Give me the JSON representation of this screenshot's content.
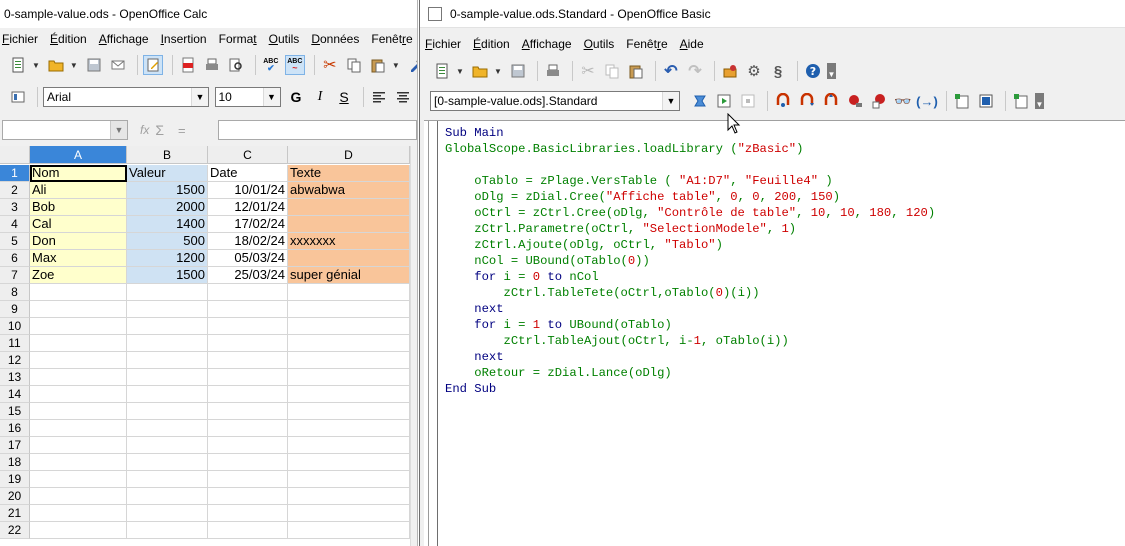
{
  "calc": {
    "title": "0-sample-value.ods - OpenOffice Calc",
    "menus": [
      "Fichier",
      "Édition",
      "Affichage",
      "Insertion",
      "Format",
      "Outils",
      "Données",
      "Fenêtre"
    ],
    "font_name": "Arial",
    "font_size": "10",
    "format_labels": {
      "bold": "G",
      "italic": "I",
      "underline": "S"
    },
    "formula_fx": "fx",
    "formula_sigma": "Σ",
    "formula_equals": "=",
    "name_box": "",
    "input_line": "",
    "columns": [
      "A",
      "B",
      "C",
      "D"
    ],
    "selected_column": "A",
    "row_numbers": [
      "1",
      "2",
      "3",
      "4",
      "5",
      "6",
      "7",
      "8",
      "9",
      "10",
      "11",
      "12",
      "13",
      "14",
      "15",
      "16",
      "17",
      "18",
      "19",
      "20",
      "21",
      "22"
    ],
    "rows": [
      [
        "Nom",
        "Valeur",
        "Date",
        "Texte"
      ],
      [
        "Ali",
        "1500",
        "10/01/24",
        "abwabwa"
      ],
      [
        "Bob",
        "2000",
        "12/01/24",
        ""
      ],
      [
        "Cal",
        "1400",
        "17/02/24",
        ""
      ],
      [
        "Don",
        "500",
        "18/02/24",
        "xxxxxxx"
      ],
      [
        "Max",
        "1200",
        "05/03/24",
        ""
      ],
      [
        "Zoe",
        "1500",
        "25/03/24",
        "super génial"
      ]
    ]
  },
  "basic": {
    "title": "0-sample-value.ods.Standard - OpenOffice Basic",
    "menus": [
      "Fichier",
      "Édition",
      "Affichage",
      "Outils",
      "Fenêtre",
      "Aide"
    ],
    "library_selector": "[0-sample-value.ods].Standard",
    "code_lines": [
      [
        {
          "t": "Sub Main",
          "c": "kw"
        }
      ],
      [
        {
          "t": "GlobalScope.BasicLibraries.loadLibrary (",
          "c": "id"
        },
        {
          "t": "\"zBasic\"",
          "c": "str"
        },
        {
          "t": ")",
          "c": "id"
        }
      ],
      [
        {
          "t": "",
          "c": "kw"
        }
      ],
      [
        {
          "t": "    oTablo = zPlage.VersTable ( ",
          "c": "id"
        },
        {
          "t": "\"A1:D7\"",
          "c": "str"
        },
        {
          "t": ", ",
          "c": "id"
        },
        {
          "t": "\"Feuille4\"",
          "c": "str"
        },
        {
          "t": " )",
          "c": "id"
        }
      ],
      [
        {
          "t": "    oDlg = zDial.Cree(",
          "c": "id"
        },
        {
          "t": "\"Affiche table\"",
          "c": "str"
        },
        {
          "t": ", ",
          "c": "id"
        },
        {
          "t": "0",
          "c": "numc"
        },
        {
          "t": ", ",
          "c": "id"
        },
        {
          "t": "0",
          "c": "numc"
        },
        {
          "t": ", ",
          "c": "id"
        },
        {
          "t": "200",
          "c": "numc"
        },
        {
          "t": ", ",
          "c": "id"
        },
        {
          "t": "150",
          "c": "numc"
        },
        {
          "t": ")",
          "c": "id"
        }
      ],
      [
        {
          "t": "    oCtrl = zCtrl.Cree(oDlg, ",
          "c": "id"
        },
        {
          "t": "\"Contrôle de table\"",
          "c": "str"
        },
        {
          "t": ", ",
          "c": "id"
        },
        {
          "t": "10",
          "c": "numc"
        },
        {
          "t": ", ",
          "c": "id"
        },
        {
          "t": "10",
          "c": "numc"
        },
        {
          "t": ", ",
          "c": "id"
        },
        {
          "t": "180",
          "c": "numc"
        },
        {
          "t": ", ",
          "c": "id"
        },
        {
          "t": "120",
          "c": "numc"
        },
        {
          "t": ")",
          "c": "id"
        }
      ],
      [
        {
          "t": "    zCtrl.Parametre(oCtrl, ",
          "c": "id"
        },
        {
          "t": "\"SelectionModele\"",
          "c": "str"
        },
        {
          "t": ", ",
          "c": "id"
        },
        {
          "t": "1",
          "c": "numc"
        },
        {
          "t": ")",
          "c": "id"
        }
      ],
      [
        {
          "t": "    zCtrl.Ajoute(oDlg, oCtrl, ",
          "c": "id"
        },
        {
          "t": "\"Tablo\"",
          "c": "str"
        },
        {
          "t": ")",
          "c": "id"
        }
      ],
      [
        {
          "t": "    nCol = UBound(oTablo(",
          "c": "id"
        },
        {
          "t": "0",
          "c": "numc"
        },
        {
          "t": "))",
          "c": "id"
        }
      ],
      [
        {
          "t": "    for",
          "c": "kw"
        },
        {
          "t": " i = ",
          "c": "id"
        },
        {
          "t": "0",
          "c": "numc"
        },
        {
          "t": " to",
          "c": "kw"
        },
        {
          "t": " nCol",
          "c": "id"
        }
      ],
      [
        {
          "t": "        zCtrl.TableTete(oCtrl,oTablo(",
          "c": "id"
        },
        {
          "t": "0",
          "c": "numc"
        },
        {
          "t": ")(i))",
          "c": "id"
        }
      ],
      [
        {
          "t": "    next",
          "c": "kw"
        }
      ],
      [
        {
          "t": "    for",
          "c": "kw"
        },
        {
          "t": " i = ",
          "c": "id"
        },
        {
          "t": "1",
          "c": "numc"
        },
        {
          "t": " to",
          "c": "kw"
        },
        {
          "t": " UBound(oTablo)",
          "c": "id"
        }
      ],
      [
        {
          "t": "        zCtrl.TableAjout(oCtrl, i-",
          "c": "id"
        },
        {
          "t": "1",
          "c": "numc"
        },
        {
          "t": ", oTablo(i))",
          "c": "id"
        }
      ],
      [
        {
          "t": "    next",
          "c": "kw"
        }
      ],
      [
        {
          "t": "    oRetour = zDial.Lance(oDlg)",
          "c": "id"
        }
      ],
      [
        {
          "t": "End Sub",
          "c": "kw"
        }
      ]
    ]
  },
  "colors": {
    "col_a_fill": "#ffffcc",
    "col_b_fill": "#cfe2f3",
    "col_d_fill": "#f9c59a",
    "selected_header": "#3a86d9",
    "code_keyword": "#000080",
    "code_identifier": "#008000",
    "code_string": "#ce0000"
  },
  "icons": {
    "calc_tb1": [
      "new-document-icon",
      "open-folder-icon",
      "save-icon",
      "email-icon",
      "edit-mode-icon",
      "export-pdf-icon",
      "print-icon",
      "print-preview-icon",
      "spellcheck-icon",
      "auto-spellcheck-icon",
      "cut-icon",
      "copy-icon",
      "paste-icon",
      "format-paintbrush-icon"
    ],
    "basic_tb1": [
      "new-document-icon",
      "open-folder-icon",
      "save-icon",
      "print-icon",
      "cut-icon",
      "copy-icon",
      "paste-icon",
      "undo-icon",
      "redo-icon",
      "macros-icon",
      "gear-icon",
      "basic-ide-icon",
      "help-icon"
    ],
    "basic_tb2": [
      "compile-icon",
      "run-icon",
      "stop-icon",
      "step-into-icon",
      "step-over-icon",
      "step-out-icon",
      "breakpoint-icon",
      "manage-breakpoints-icon",
      "watch-icon",
      "object-catalog-icon",
      "macros-select-icon",
      "modules-icon",
      "insert-controls-icon"
    ]
  }
}
